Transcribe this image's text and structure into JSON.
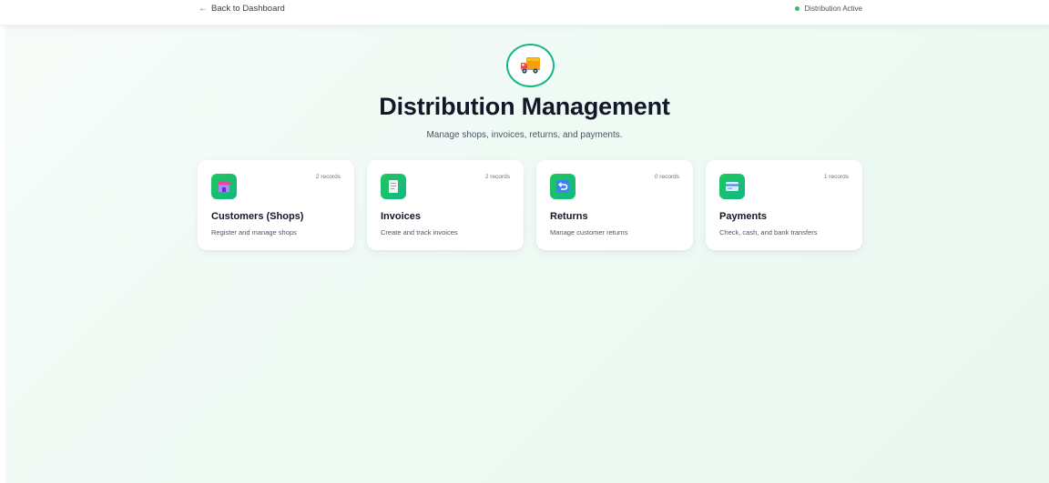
{
  "header": {
    "back_label": "Back to Dashboard",
    "back_arrow": "←",
    "status_label": "Distribution Active",
    "status_color": "#22c55e"
  },
  "hero": {
    "icon": "delivery-truck-icon",
    "title": "Distribution Management",
    "subtitle": "Manage shops, invoices, returns, and payments."
  },
  "cards": [
    {
      "icon": "shop-icon",
      "count": "2 records",
      "title": "Customers (Shops)",
      "description": "Register and manage shops"
    },
    {
      "icon": "invoice-icon",
      "count": "2 records",
      "title": "Invoices",
      "description": "Create and track invoices"
    },
    {
      "icon": "return-arrow-icon",
      "count": "0 records",
      "title": "Returns",
      "description": "Manage customer returns"
    },
    {
      "icon": "credit-card-icon",
      "count": "1 records",
      "title": "Payments",
      "description": "Check, cash, and bank transfers"
    }
  ],
  "colors": {
    "accent": "#10b981",
    "accent_light": "#22c55e",
    "title_text": "#111827",
    "muted_text": "#4b5563"
  }
}
